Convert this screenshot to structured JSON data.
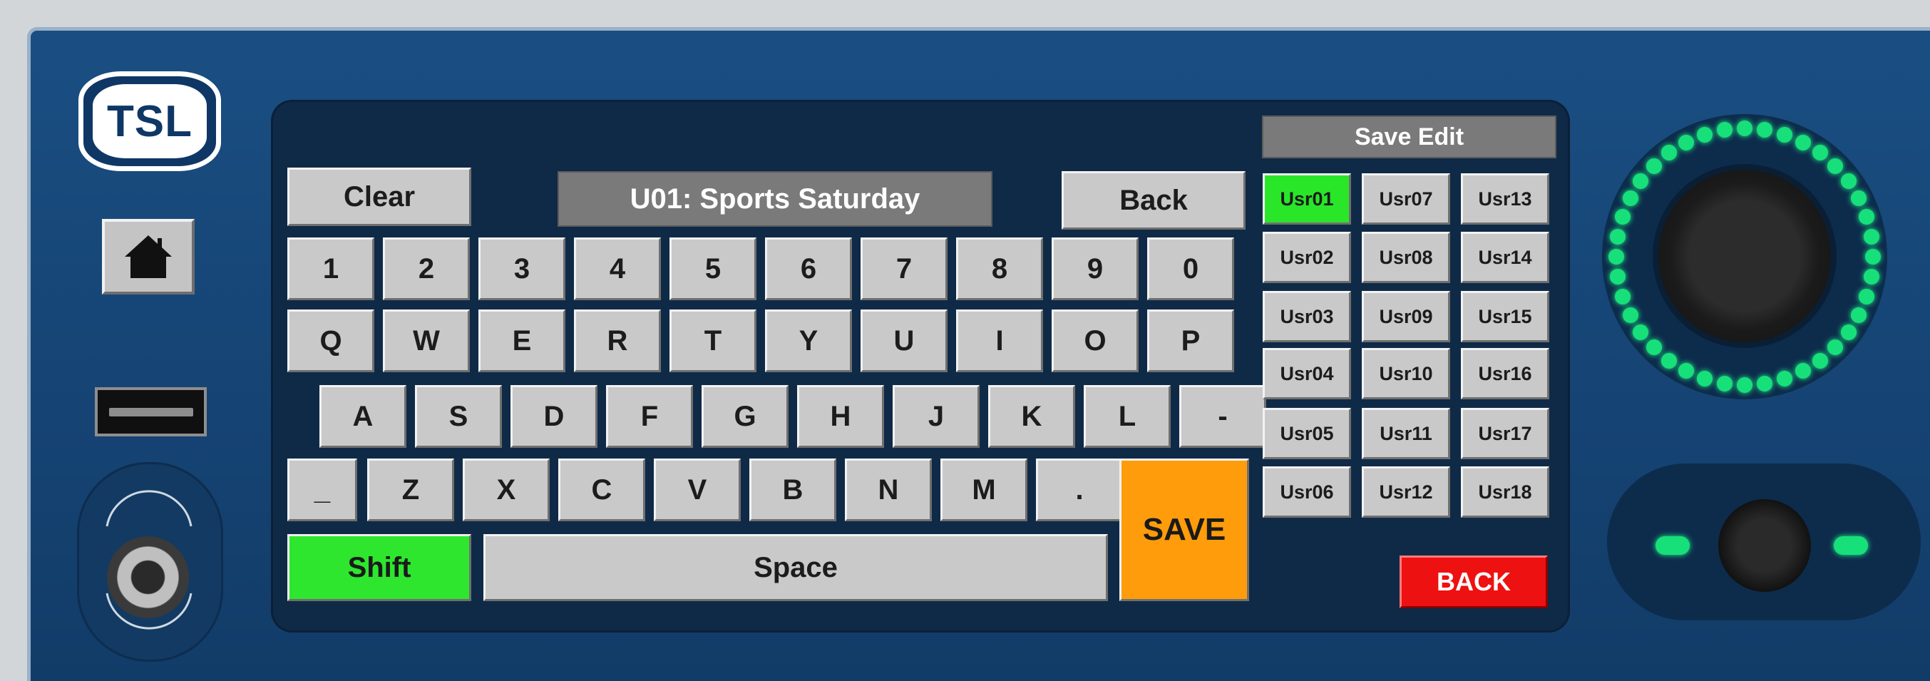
{
  "brand": {
    "logo_text": "TSL"
  },
  "editor": {
    "clear_label": "Clear",
    "title": "U01: Sports Saturday",
    "back_label": "Back",
    "save_label": "SAVE",
    "shift_label": "Shift",
    "space_label": "Space"
  },
  "keyboard": {
    "row_numbers": [
      "1",
      "2",
      "3",
      "4",
      "5",
      "6",
      "7",
      "8",
      "9",
      "0"
    ],
    "row_q": [
      "Q",
      "W",
      "E",
      "R",
      "T",
      "Y",
      "U",
      "I",
      "O",
      "P"
    ],
    "row_a": [
      "A",
      "S",
      "D",
      "F",
      "G",
      "H",
      "J",
      "K",
      "L",
      "-"
    ],
    "row_z": [
      "_",
      "Z",
      "X",
      "C",
      "V",
      "B",
      "N",
      "M",
      "."
    ]
  },
  "save_edit": {
    "header": "Save Edit",
    "slots": [
      [
        "Usr01",
        "Usr07",
        "Usr13"
      ],
      [
        "Usr02",
        "Usr08",
        "Usr14"
      ],
      [
        "Usr03",
        "Usr09",
        "Usr15"
      ],
      [
        "Usr04",
        "Usr10",
        "Usr16"
      ],
      [
        "Usr05",
        "Usr11",
        "Usr17"
      ],
      [
        "Usr06",
        "Usr12",
        "Usr18"
      ]
    ],
    "active_slot": "Usr01",
    "back_label": "BACK"
  },
  "colors": {
    "active_green": "#29e629",
    "save_orange": "#ff9c0c",
    "back_red": "#ee1111",
    "led_green": "#17e07a"
  }
}
